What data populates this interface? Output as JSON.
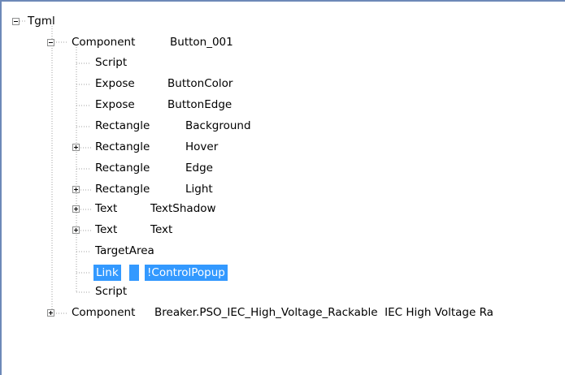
{
  "tree": {
    "root": {
      "label": "Tgml",
      "expanded": true
    },
    "component1": {
      "label": "Component",
      "value": "Button_001",
      "expanded": true,
      "children": [
        {
          "label": "Script",
          "value": "",
          "has_children": false
        },
        {
          "label": "Expose",
          "value": "ButtonColor",
          "has_children": false
        },
        {
          "label": "Expose",
          "value": "ButtonEdge",
          "has_children": false
        },
        {
          "label": "Rectangle",
          "value": "Background",
          "has_children": false
        },
        {
          "label": "Rectangle",
          "value": "Hover",
          "has_children": true
        },
        {
          "label": "Rectangle",
          "value": "Edge",
          "has_children": false
        },
        {
          "label": "Rectangle",
          "value": "Light",
          "has_children": true
        },
        {
          "label": "Text",
          "value": "TextShadow",
          "has_children": true
        },
        {
          "label": "Text",
          "value": "Text",
          "has_children": true
        },
        {
          "label": "TargetArea",
          "value": "",
          "has_children": false
        },
        {
          "label": "Link",
          "value": "!ControlPopup",
          "has_children": false,
          "selected": true
        },
        {
          "label": "Script",
          "value": "",
          "has_children": false
        }
      ]
    },
    "component2": {
      "label": "Component",
      "value": "Breaker.PSO_IEC_High_Voltage_Rackable  IEC High Voltage Ra",
      "expanded": false
    }
  },
  "colors": {
    "selection": "#3399ff",
    "tree_lines": "#a0a0a0",
    "panel_border": "#6d89b8"
  }
}
